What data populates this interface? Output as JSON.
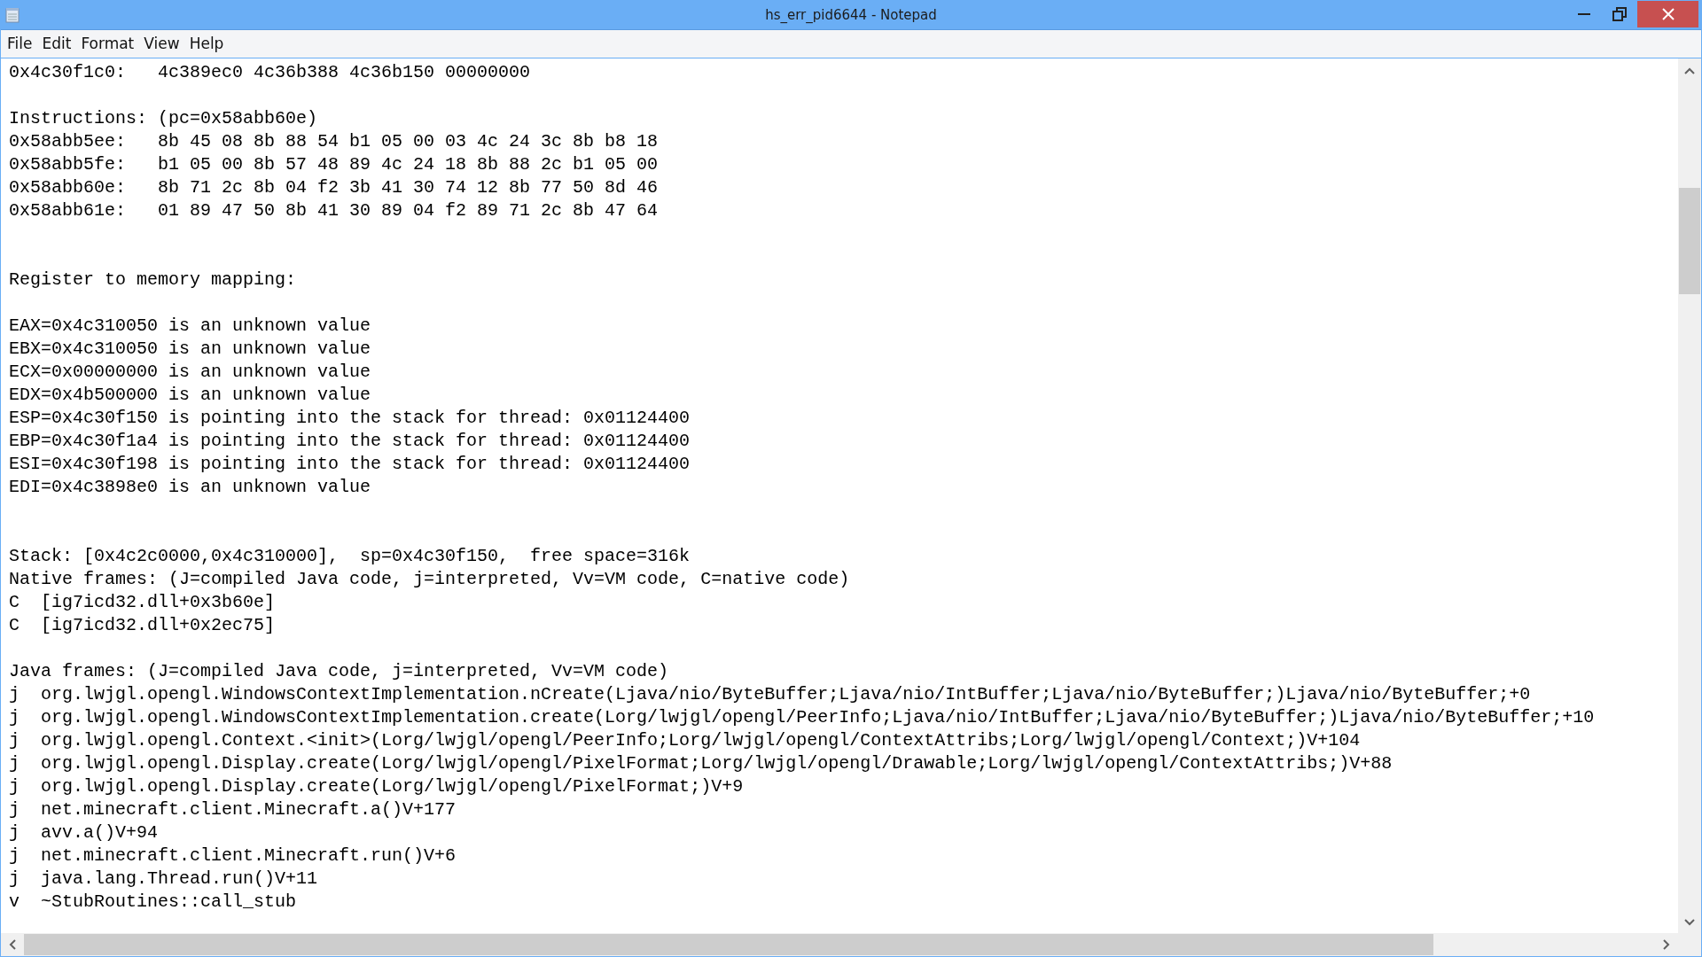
{
  "window": {
    "title": "hs_err_pid6644 - Notepad"
  },
  "menu": [
    "File",
    "Edit",
    "Format",
    "View",
    "Help"
  ],
  "lines": [
    {
      "kind": "text",
      "text": "0x4c30f1c0:   4c389ec0 4c36b388 4c36b150 00000000"
    },
    {
      "kind": "blank"
    },
    {
      "kind": "text",
      "text": "Instructions: (pc=0x58abb60e)"
    },
    {
      "kind": "text",
      "text": "0x58abb5ee:   8b 45 08 8b 88 54 b1 05 00 03 4c 24 3c 8b b8 18"
    },
    {
      "kind": "text",
      "text": "0x58abb5fe:   b1 05 00 8b 57 48 89 4c 24 18 8b 88 2c b1 05 00"
    },
    {
      "kind": "text",
      "text": "0x58abb60e:   8b 71 2c 8b 04 f2 3b 41 30 74 12 8b 77 50 8d 46"
    },
    {
      "kind": "text",
      "text": "0x58abb61e:   01 89 47 50 8b 41 30 89 04 f2 89 71 2c 8b 47 64"
    },
    {
      "kind": "blank"
    },
    {
      "kind": "blank"
    },
    {
      "kind": "text",
      "text": "Register to memory mapping:"
    },
    {
      "kind": "blank"
    },
    {
      "kind": "text",
      "text": "EAX=0x4c310050 is an unknown value"
    },
    {
      "kind": "text",
      "text": "EBX=0x4c310050 is an unknown value"
    },
    {
      "kind": "text",
      "text": "ECX=0x00000000 is an unknown value"
    },
    {
      "kind": "text",
      "text": "EDX=0x4b500000 is an unknown value"
    },
    {
      "kind": "text",
      "text": "ESP=0x4c30f150 is pointing into the stack for thread: 0x01124400"
    },
    {
      "kind": "text",
      "text": "EBP=0x4c30f1a4 is pointing into the stack for thread: 0x01124400"
    },
    {
      "kind": "text",
      "text": "ESI=0x4c30f198 is pointing into the stack for thread: 0x01124400"
    },
    {
      "kind": "text",
      "text": "EDI=0x4c3898e0 is an unknown value"
    },
    {
      "kind": "blank"
    },
    {
      "kind": "blank"
    },
    {
      "kind": "text",
      "text": "Stack: [0x4c2c0000,0x4c310000],  sp=0x4c30f150,  free space=316k"
    },
    {
      "kind": "text",
      "text": "Native frames: (J=compiled Java code, j=interpreted, Vv=VM code, C=native code)"
    },
    {
      "kind": "text",
      "text": "C  [ig7icd32.dll+0x3b60e]"
    },
    {
      "kind": "text",
      "text": "C  [ig7icd32.dll+0x2ec75]"
    },
    {
      "kind": "blank"
    },
    {
      "kind": "text",
      "text": "Java frames: (J=compiled Java code, j=interpreted, Vv=VM code)"
    },
    {
      "kind": "text",
      "text": "j  org.lwjgl.opengl.WindowsContextImplementation.nCreate(Ljava/nio/ByteBuffer;Ljava/nio/IntBuffer;Ljava/nio/ByteBuffer;)Ljava/nio/ByteBuffer;+0"
    },
    {
      "kind": "text",
      "text": "j  org.lwjgl.opengl.WindowsContextImplementation.create(Lorg/lwjgl/opengl/PeerInfo;Ljava/nio/IntBuffer;Ljava/nio/ByteBuffer;)Ljava/nio/ByteBuffer;+10"
    },
    {
      "kind": "text",
      "text": "j  org.lwjgl.opengl.Context.<init>(Lorg/lwjgl/opengl/PeerInfo;Lorg/lwjgl/opengl/ContextAttribs;Lorg/lwjgl/opengl/Context;)V+104"
    },
    {
      "kind": "text",
      "text": "j  org.lwjgl.opengl.Display.create(Lorg/lwjgl/opengl/PixelFormat;Lorg/lwjgl/opengl/Drawable;Lorg/lwjgl/opengl/ContextAttribs;)V+88"
    },
    {
      "kind": "text",
      "text": "j  org.lwjgl.opengl.Display.create(Lorg/lwjgl/opengl/PixelFormat;)V+9"
    },
    {
      "kind": "text",
      "text": "j  net.minecraft.client.Minecraft.a()V+177"
    },
    {
      "kind": "text",
      "text": "j  avv.a()V+94"
    },
    {
      "kind": "text",
      "text": "j  net.minecraft.client.Minecraft.run()V+6"
    },
    {
      "kind": "text",
      "text": "j  java.lang.Thread.run()V+11"
    },
    {
      "kind": "text",
      "text": "v  ~StubRoutines::call_stub"
    }
  ]
}
